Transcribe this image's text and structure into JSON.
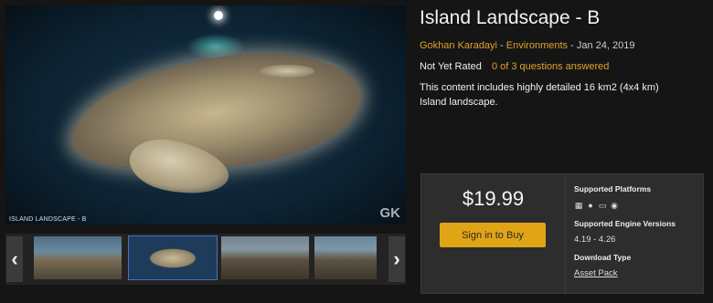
{
  "product": {
    "title": "Island Landscape - B",
    "author": "Gokhan Karadayi",
    "separator1": " - ",
    "category": "Environments",
    "separator2": " - ",
    "date": "Jan 24, 2019",
    "rating_label": "Not Yet Rated",
    "questions_link": "0 of 3 questions answered",
    "description": "This content includes highly detailed 16 km2 (4x4 km) Island landscape."
  },
  "gallery": {
    "caption": "ISLAND LANDSCAPE - B",
    "logo_text": "GK",
    "prev_icon": "chevron-left-icon",
    "next_icon": "chevron-right-icon",
    "thumbnail_count": 4,
    "selected_thumbnail": 2
  },
  "purchase": {
    "price": "$19.99",
    "button_label": "Sign in to Buy",
    "supported_platforms_label": "Supported Platforms",
    "platform_icons": [
      "windows-icon",
      "apple-icon",
      "linux-icon",
      "vr-icon"
    ],
    "engine_versions_label": "Supported Engine Versions",
    "engine_versions": "4.19 - 4.26",
    "download_type_label": "Download Type",
    "download_type": "Asset Pack"
  },
  "colors": {
    "accent": "#e0a22a",
    "button_bg": "#e0a517",
    "page_bg": "#151515",
    "panel_bg": "#2d2d2d"
  }
}
